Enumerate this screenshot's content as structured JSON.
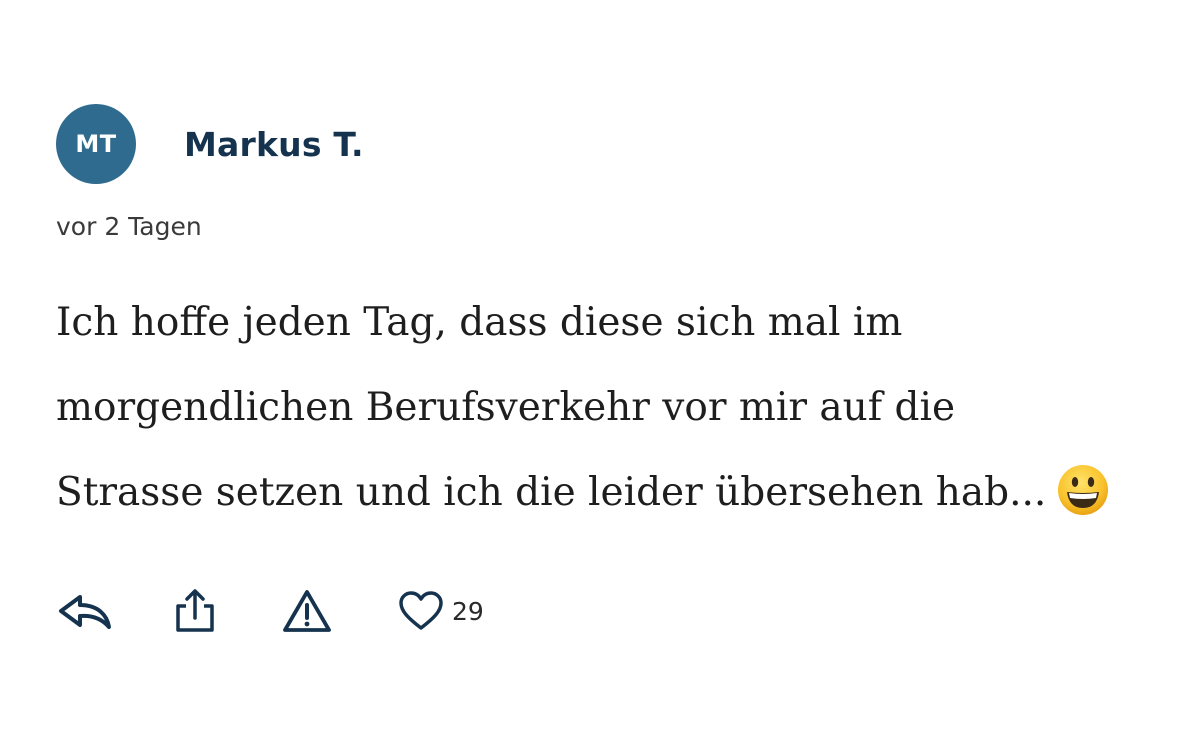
{
  "comment": {
    "avatar_initials": "MT",
    "author": "Markus T.",
    "timestamp": "vor 2 Tagen",
    "body_lines": [
      "Ich hoffe jeden Tag, dass diese sich mal im",
      "morgendlichen Berufsverkehr vor mir auf die",
      "Strasse setzen und ich die leider übersehen hab..."
    ],
    "emoji": "grinning-face-emoji"
  },
  "actions": {
    "reply_icon": "reply-icon",
    "share_icon": "share-icon",
    "report_icon": "warning-icon",
    "like_icon": "heart-icon",
    "like_count": "29"
  },
  "colors": {
    "avatar_bg": "#2e6b8f",
    "author": "#15334f",
    "icon": "#15334f",
    "body_text": "#1e1e1e"
  }
}
